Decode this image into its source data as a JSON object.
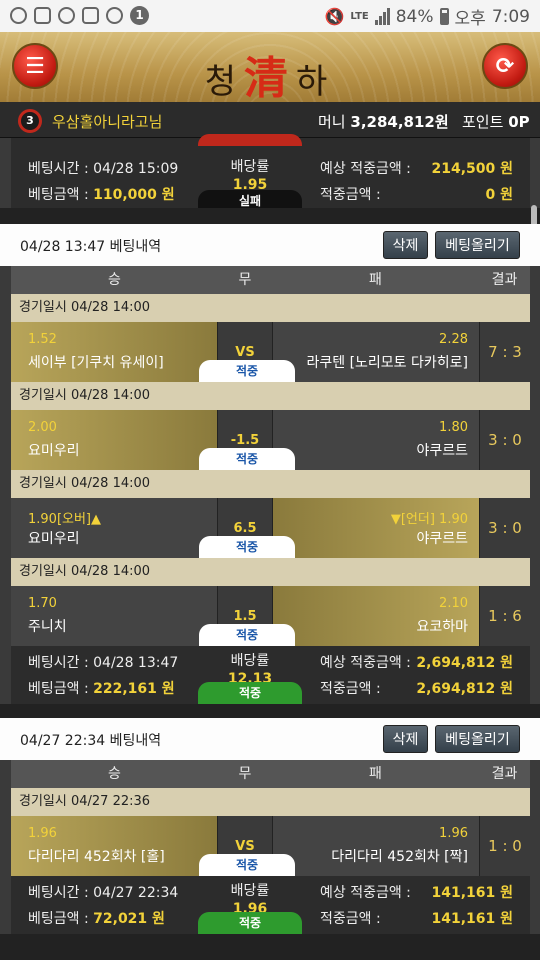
{
  "status": {
    "battery": "84%",
    "ampm": "오후",
    "time": "7:09",
    "notif_count": "1",
    "lte": "LTE"
  },
  "header": {
    "logo_left": "청",
    "logo_mid": "清",
    "logo_right": "하"
  },
  "user": {
    "level": "3",
    "name": "우삼홀아니라고님",
    "money_label": "머니",
    "money": "3,284,812원",
    "point_label": "포인트",
    "point": "0P"
  },
  "cols": {
    "win": "승",
    "draw": "무",
    "lose": "패",
    "result": "결과"
  },
  "labels": {
    "bet_time": "베팅시간 :",
    "bet_amount": "베팅금액 :",
    "ratio": "배당률",
    "expected": "예상 적중금액 :",
    "won": "적중금액 :",
    "delete": "삭제",
    "repost": "베팅올리기",
    "match_date_prefix": "경기일시",
    "hit": "적중",
    "miss": "실패"
  },
  "top": {
    "bet_time": "04/28 15:09",
    "bet_amount": "110,000 원",
    "ratio": "1.95",
    "status": "실패",
    "expected": "214,500 원",
    "won": "0 원"
  },
  "history1": {
    "title": "04/28 13:47 베팅내역",
    "bet_time": "04/28 13:47",
    "bet_amount": "222,161 원",
    "ratio": "12.13",
    "status": "적중",
    "expected": "2,694,812 원",
    "won": "2,694,812 원",
    "matches": [
      {
        "date": "경기일시 04/28 14:00",
        "home_odd": "1.52",
        "home": "세이부 [기쿠치 유세이]",
        "draw": "VS",
        "away_odd": "2.28",
        "away": "라쿠텐 [노리모토 다카히로]",
        "result": "7 : 3",
        "status": "적중"
      },
      {
        "date": "경기일시 04/28 14:00",
        "home_odd": "2.00",
        "home": "요미우리",
        "draw": "-1.5",
        "away_odd": "1.80",
        "away": "야쿠르트",
        "result": "3 : 0",
        "status": "적중"
      },
      {
        "date": "경기일시 04/28 14:00",
        "home_odd": "1.90[오버]▲",
        "home": "요미우리",
        "draw": "6.5",
        "away_odd": "▼[언더] 1.90",
        "away": "야쿠르트",
        "result": "3 : 0",
        "status": "적중"
      },
      {
        "date": "경기일시 04/28 14:00",
        "home_odd": "1.70",
        "home": "주니치",
        "draw": "1.5",
        "away_odd": "2.10",
        "away": "요코하마",
        "result": "1 : 6",
        "status": "적중"
      }
    ]
  },
  "history2": {
    "title": "04/27 22:34 베팅내역",
    "bet_time": "04/27 22:34",
    "bet_amount": "72,021 원",
    "ratio": "1.96",
    "status": "적중",
    "expected": "141,161 원",
    "won": "141,161 원",
    "matches": [
      {
        "date": "경기일시 04/27 22:36",
        "home_odd": "1.96",
        "home": "다리다리 452회차 [홀]",
        "draw": "VS",
        "away_odd": "1.96",
        "away": "다리다리 452회차 [짝]",
        "result": "1 : 0",
        "status": "적중"
      }
    ]
  }
}
